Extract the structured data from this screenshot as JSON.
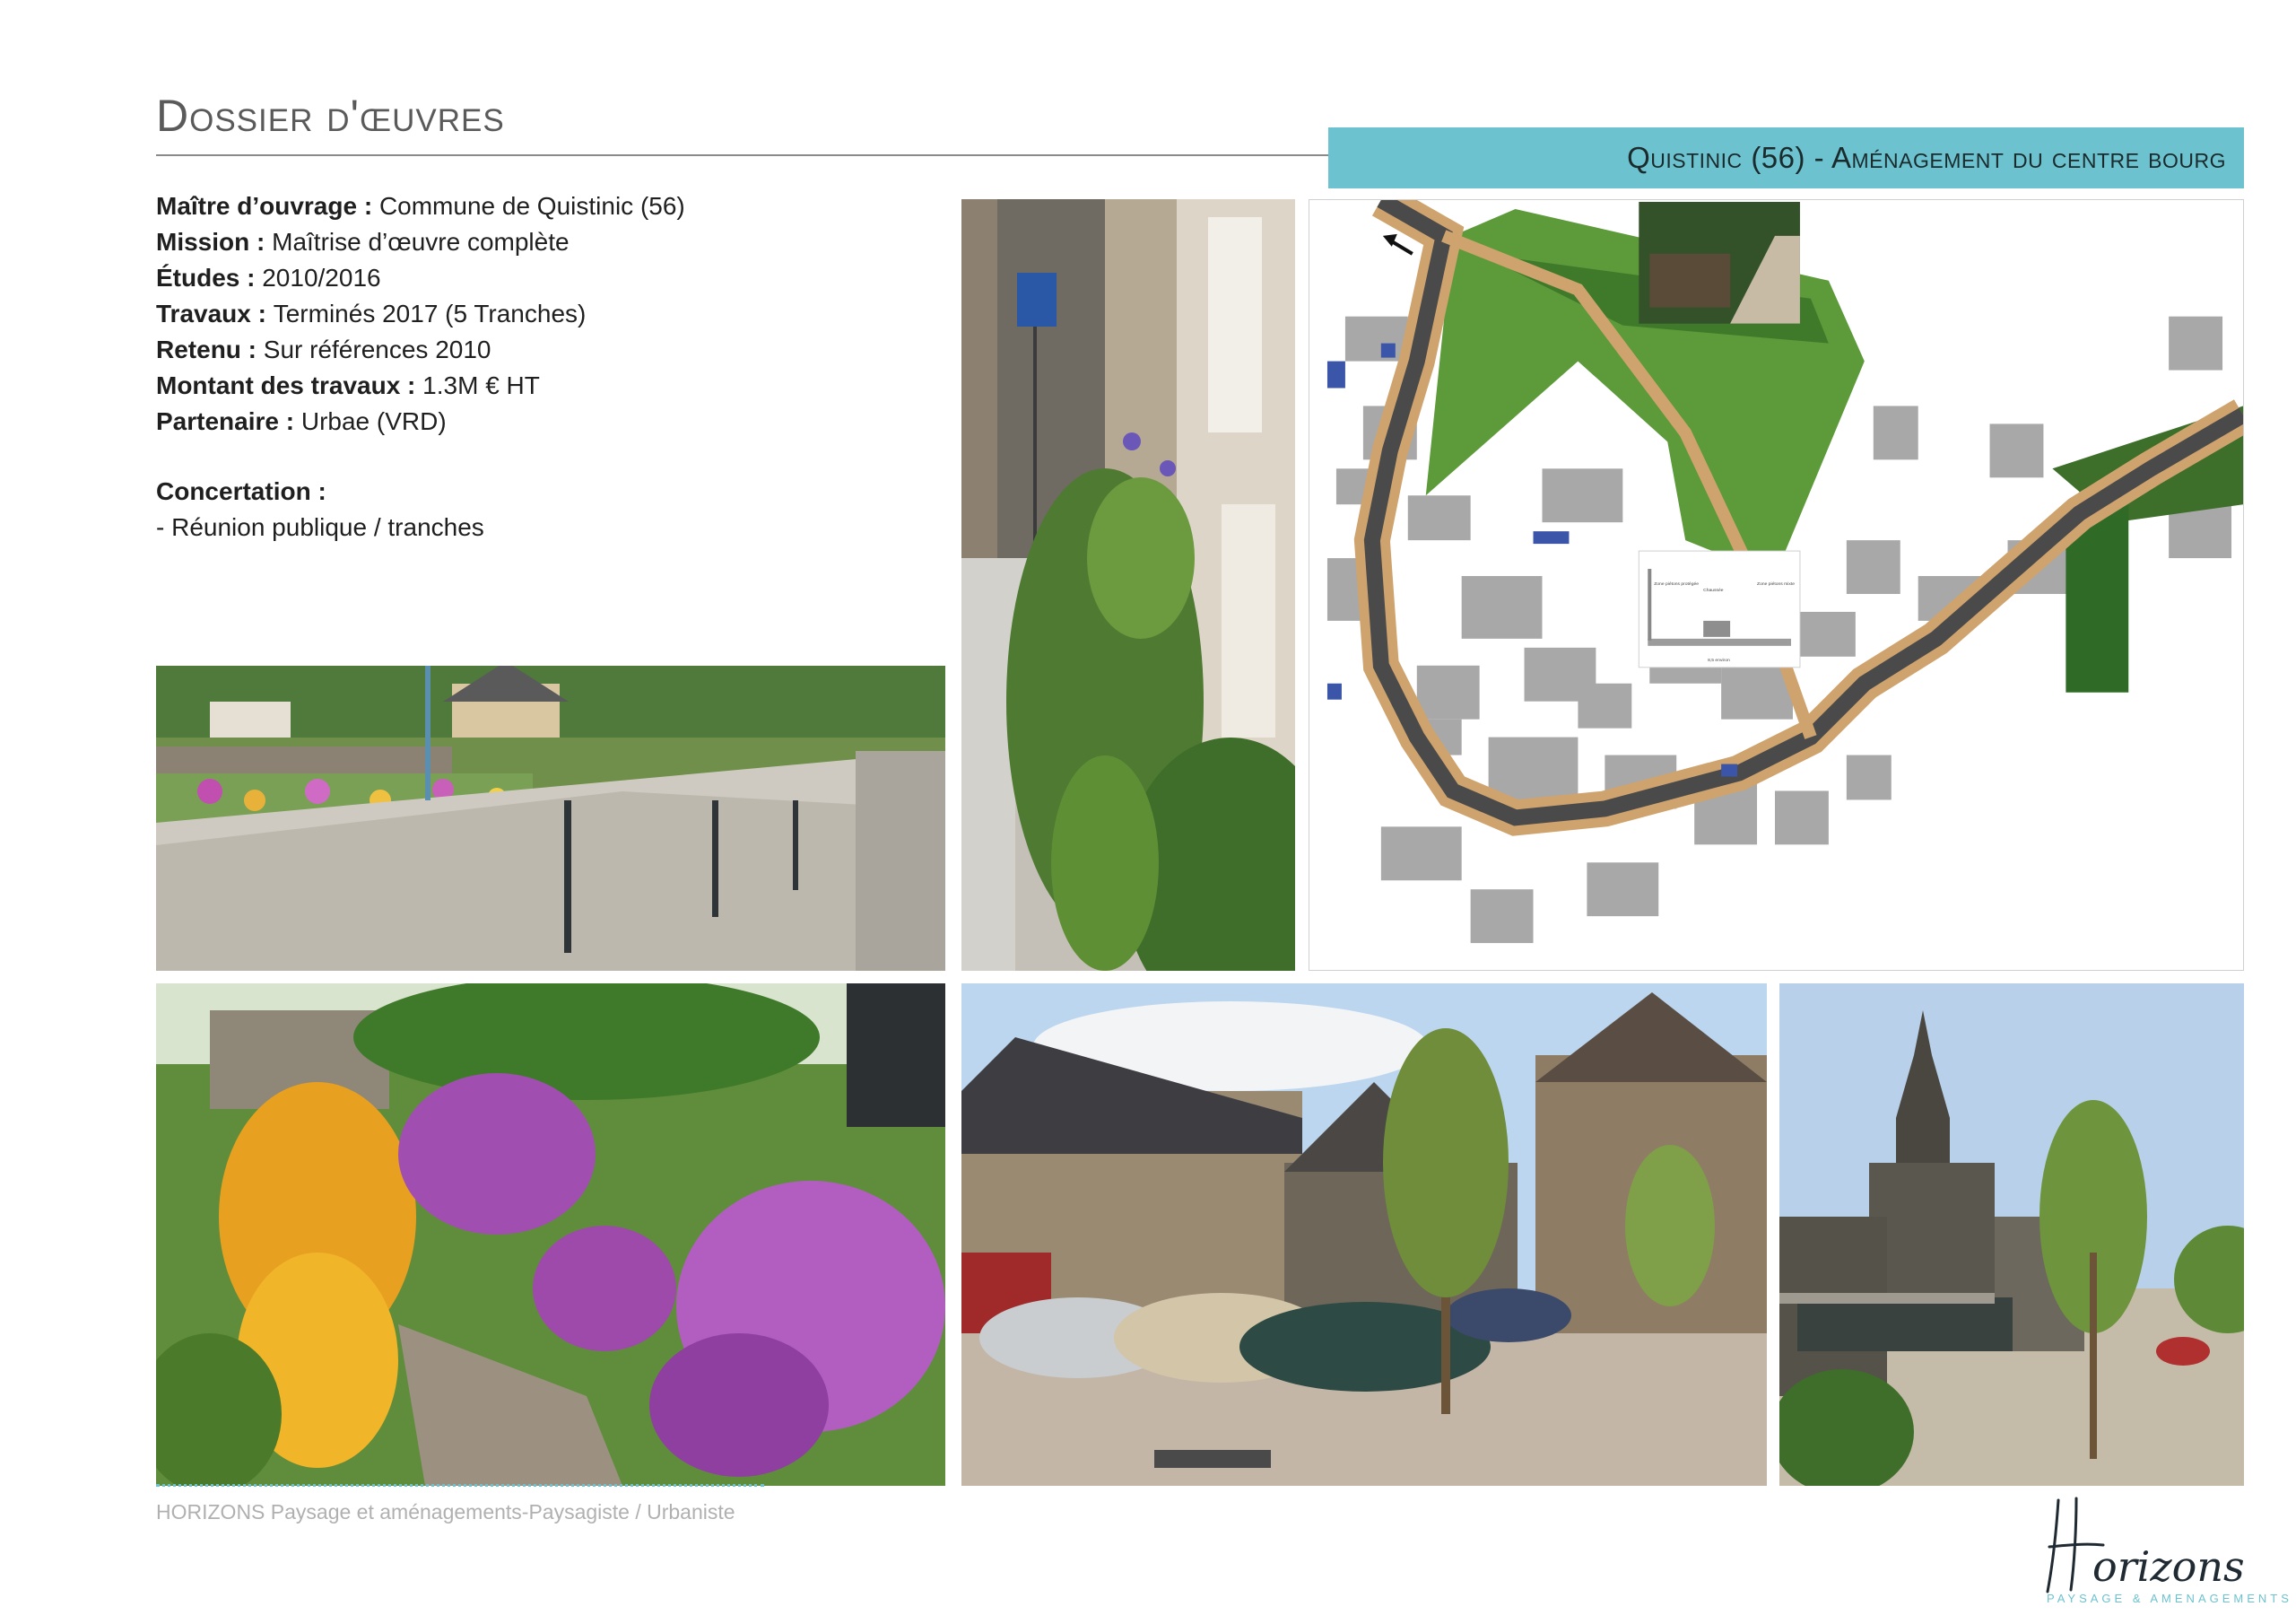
{
  "header": {
    "title": "Dossier d'œuvres",
    "project_title": "Quistinic (56) - Aménagement du centre bourg"
  },
  "info": {
    "maitre_label": "Maître d’ouvrage  : ",
    "maitre_value": "Commune de Quistinic (56)",
    "mission_label": "Mission : ",
    "mission_value": "Maîtrise d’œuvre complète",
    "etudes_label": "Études : ",
    "etudes_value": "2010/2016",
    "travaux_label": "Travaux : ",
    "travaux_value": "Terminés 2017 (5 Tranches)",
    "retenu_label": "Retenu : ",
    "retenu_value": "Sur références 2010",
    "montant_label": "Montant des travaux : ",
    "montant_value": "1.3M € HT",
    "partenaire_label": "Partenaire : ",
    "partenaire_value": "Urbae (VRD)",
    "concertation_label": "Concertation :",
    "concertation_value": "- Réunion publique / tranches"
  },
  "plan": {
    "section_label_left": "Zone piétons protégée",
    "section_label_mid": "Chaussée",
    "section_label_right": "Zone piétons mixte",
    "section_total": "8,5 environ"
  },
  "footer": {
    "text": "HORIZONS Paysage et aménagements-Paysagiste / Urbaniste"
  },
  "logo": {
    "wordmark": "Horizons",
    "tagline": "PAYSAGE & AMENAGEMENTS"
  },
  "colors": {
    "accent": "#6cc3cf",
    "rule": "#8a8a8a"
  }
}
